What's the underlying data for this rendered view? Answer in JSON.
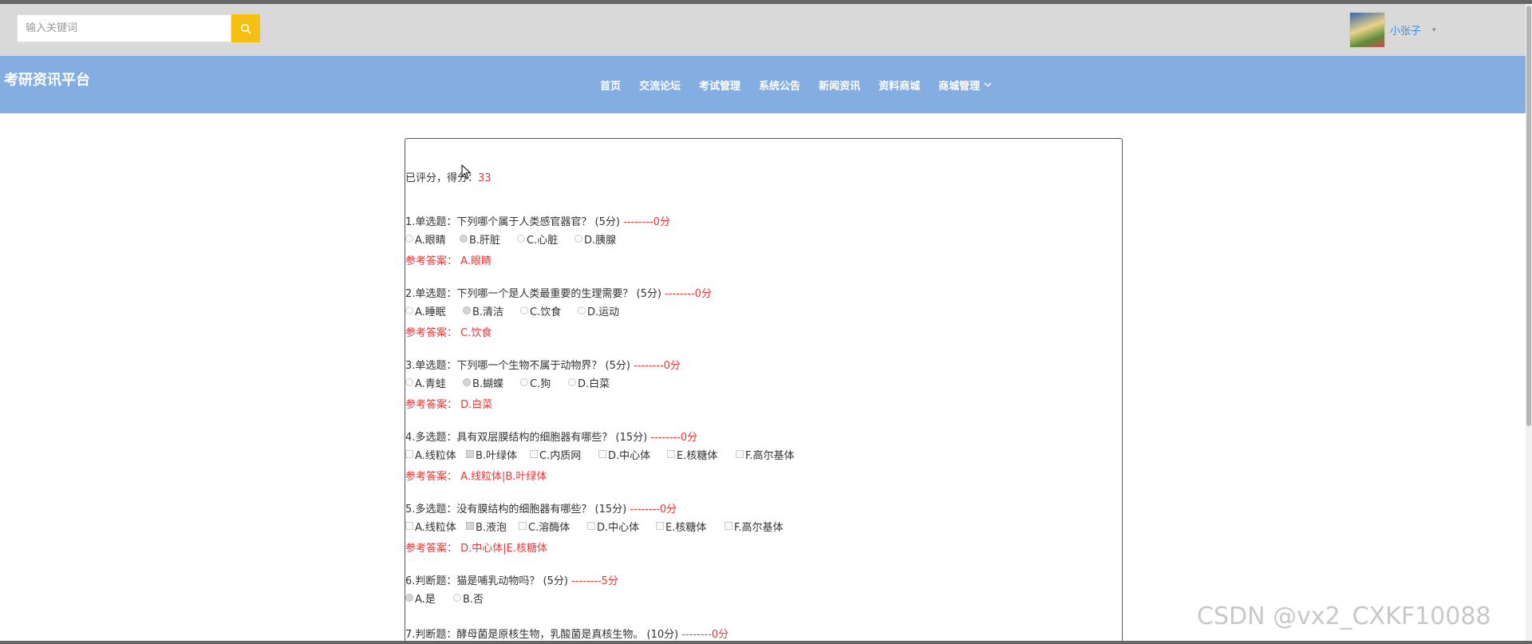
{
  "header": {
    "search_placeholder": "输入关键词",
    "username": "小张子",
    "caret": "▾"
  },
  "nav": {
    "site_title": "考研资讯平台",
    "items": [
      "首页",
      "交流论坛",
      "考试管理",
      "系统公告",
      "新闻资讯",
      "资料商城",
      "商城管理"
    ]
  },
  "exam": {
    "score_label": "已评分，得分：",
    "score_value": "33",
    "answer_label": "参考答案：",
    "questions": [
      {
        "title": "1.单选题：下列哪个属于人类感官器官？ (5分)",
        "mark": "--------0分",
        "type": "radio",
        "options": [
          "A.眼睛",
          "B.肝脏",
          "C.心脏",
          "D.胰腺"
        ],
        "selected": [
          1
        ],
        "answer": "A.眼睛"
      },
      {
        "title": "2.单选题：下列哪一个是人类最重要的生理需要？ (5分)",
        "mark": "--------0分",
        "type": "radio",
        "options": [
          "A.睡眠",
          "B.清洁",
          "C.饮食",
          "D.运动"
        ],
        "selected": [
          1
        ],
        "answer": "C.饮食"
      },
      {
        "title": "3.单选题：下列哪一个生物不属于动物界？ (5分)",
        "mark": "--------0分",
        "type": "radio",
        "options": [
          "A.青蛙",
          "B.蝴蝶",
          "C.狗",
          "D.白菜"
        ],
        "selected": [
          1
        ],
        "answer": "D.白菜"
      },
      {
        "title": "4.多选题：具有双层膜结构的细胞器有哪些？ (15分)",
        "mark": "--------0分",
        "type": "checkbox",
        "options": [
          "A.线粒体",
          "B.叶绿体",
          "C.内质网",
          "D.中心体",
          "E.核糖体",
          "F.高尔基体"
        ],
        "selected": [
          1
        ],
        "answer": "A.线粒体|B.叶绿体"
      },
      {
        "title": "5.多选题：没有膜结构的细胞器有哪些？ (15分)",
        "mark": "--------0分",
        "type": "checkbox",
        "options": [
          "A.线粒体",
          "B.液泡",
          "C.溶酶体",
          "D.中心体",
          "E.核糖体",
          "F.高尔基体"
        ],
        "selected": [
          1
        ],
        "answer": "D.中心体|E.核糖体"
      },
      {
        "title": "6.判断题：猫是哺乳动物吗？ (5分)",
        "mark": "--------5分",
        "type": "radio",
        "options": [
          "A.是",
          "B.否"
        ],
        "selected": [
          0
        ],
        "answer": ""
      },
      {
        "title": "7.判断题：酵母菌是原核生物，乳酸菌是真核生物。 (10分)",
        "mark": "--------0分",
        "type": "radio",
        "options": [],
        "selected": [],
        "answer": ""
      }
    ]
  },
  "watermark": "CSDN @vx2_CXKF10088"
}
